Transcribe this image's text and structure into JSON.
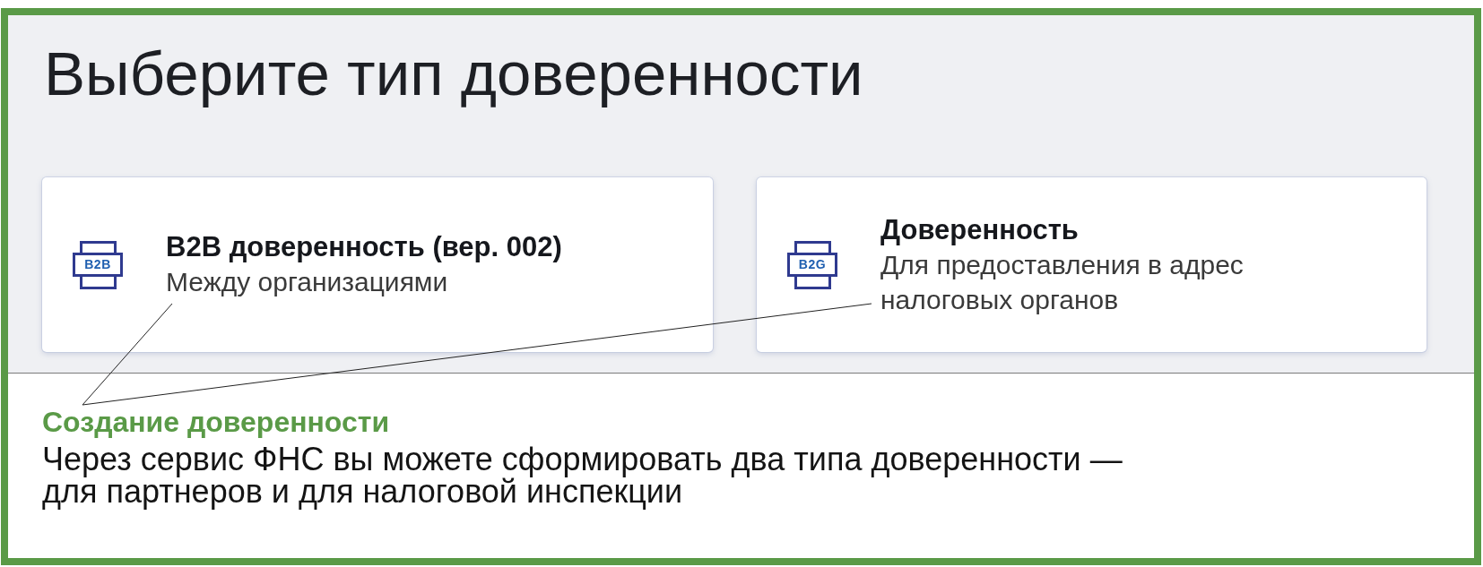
{
  "heading": "Выберите тип доверенности",
  "cards": [
    {
      "icon_text": "B2B",
      "title": "B2B доверенность (вер. 002)",
      "subtitle": "Между организациями"
    },
    {
      "icon_text": "B2G",
      "title": "Доверенность",
      "subtitle": "Для предоставления в адрес\nналоговых органов"
    }
  ],
  "caption": {
    "title": "Создание доверенности",
    "text": "Через сервис ФНС вы можете сформировать два типа доверенности —\nдля партнеров и для налоговой инспекции"
  }
}
